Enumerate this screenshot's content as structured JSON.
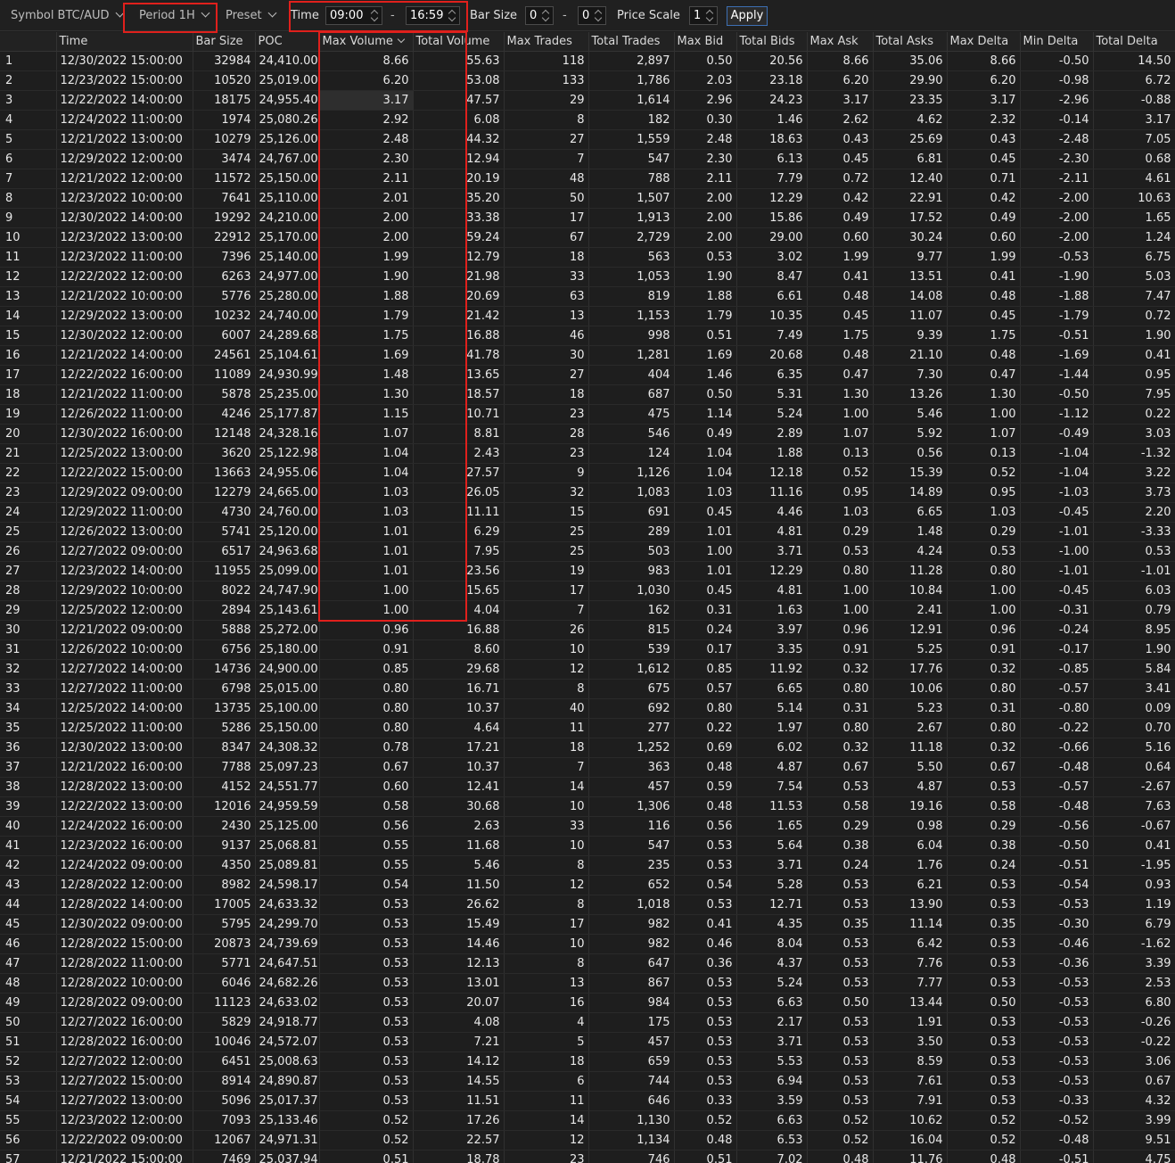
{
  "toolbar": {
    "symbol_label": "Symbol BTC/AUD",
    "period_label": "Period 1H",
    "preset_label": "Preset",
    "time_label": "Time",
    "time_from": "09:00",
    "time_dash": "-",
    "time_to": "16:59",
    "barsize_label": "Bar Size",
    "barsize_from": "0",
    "barsize_dash": "-",
    "barsize_to": "0",
    "pricescale_label": "Price Scale",
    "pricescale_value": "1",
    "apply_label": "Apply"
  },
  "table": {
    "columns": [
      "",
      "Time",
      "Bar Size",
      "POC",
      "Max Volume",
      "Total Volume",
      "Max Trades",
      "Total Trades",
      "Max Bid",
      "Total Bids",
      "Max Ask",
      "Total Asks",
      "Max Delta",
      "Min Delta",
      "Total Delta"
    ],
    "sorted_column": "Max Volume",
    "rows": [
      [
        "1",
        "12/30/2022 15:00:00",
        "32984",
        "24,410.00",
        "8.66",
        "55.63",
        "118",
        "2,897",
        "0.50",
        "20.56",
        "8.66",
        "35.06",
        "8.66",
        "-0.50",
        "14.50"
      ],
      [
        "2",
        "12/23/2022 15:00:00",
        "10520",
        "25,019.00",
        "6.20",
        "53.08",
        "133",
        "1,786",
        "2.03",
        "23.18",
        "6.20",
        "29.90",
        "6.20",
        "-0.98",
        "6.72"
      ],
      [
        "3",
        "12/22/2022 14:00:00",
        "18175",
        "24,955.40",
        "3.17",
        "47.57",
        "29",
        "1,614",
        "2.96",
        "24.23",
        "3.17",
        "23.35",
        "3.17",
        "-2.96",
        "-0.88"
      ],
      [
        "4",
        "12/24/2022 11:00:00",
        "1974",
        "25,080.26",
        "2.92",
        "6.08",
        "8",
        "182",
        "0.30",
        "1.46",
        "2.62",
        "4.62",
        "2.32",
        "-0.14",
        "3.17"
      ],
      [
        "5",
        "12/21/2022 13:00:00",
        "10279",
        "25,126.00",
        "2.48",
        "44.32",
        "27",
        "1,559",
        "2.48",
        "18.63",
        "0.43",
        "25.69",
        "0.43",
        "-2.48",
        "7.05"
      ],
      [
        "6",
        "12/29/2022 12:00:00",
        "3474",
        "24,767.00",
        "2.30",
        "12.94",
        "7",
        "547",
        "2.30",
        "6.13",
        "0.45",
        "6.81",
        "0.45",
        "-2.30",
        "0.68"
      ],
      [
        "7",
        "12/21/2022 12:00:00",
        "11572",
        "25,150.00",
        "2.11",
        "20.19",
        "48",
        "788",
        "2.11",
        "7.79",
        "0.72",
        "12.40",
        "0.71",
        "-2.11",
        "4.61"
      ],
      [
        "8",
        "12/23/2022 10:00:00",
        "7641",
        "25,110.00",
        "2.01",
        "35.20",
        "50",
        "1,507",
        "2.00",
        "12.29",
        "0.42",
        "22.91",
        "0.42",
        "-2.00",
        "10.63"
      ],
      [
        "9",
        "12/30/2022 14:00:00",
        "19292",
        "24,210.00",
        "2.00",
        "33.38",
        "17",
        "1,913",
        "2.00",
        "15.86",
        "0.49",
        "17.52",
        "0.49",
        "-2.00",
        "1.65"
      ],
      [
        "10",
        "12/23/2022 13:00:00",
        "22912",
        "25,170.00",
        "2.00",
        "59.24",
        "67",
        "2,729",
        "2.00",
        "29.00",
        "0.60",
        "30.24",
        "0.60",
        "-2.00",
        "1.24"
      ],
      [
        "11",
        "12/23/2022 11:00:00",
        "7396",
        "25,140.00",
        "1.99",
        "12.79",
        "18",
        "563",
        "0.53",
        "3.02",
        "1.99",
        "9.77",
        "1.99",
        "-0.53",
        "6.75"
      ],
      [
        "12",
        "12/22/2022 12:00:00",
        "6263",
        "24,977.00",
        "1.90",
        "21.98",
        "33",
        "1,053",
        "1.90",
        "8.47",
        "0.41",
        "13.51",
        "0.41",
        "-1.90",
        "5.03"
      ],
      [
        "13",
        "12/21/2022 10:00:00",
        "5776",
        "25,280.00",
        "1.88",
        "20.69",
        "63",
        "819",
        "1.88",
        "6.61",
        "0.48",
        "14.08",
        "0.48",
        "-1.88",
        "7.47"
      ],
      [
        "14",
        "12/29/2022 13:00:00",
        "10232",
        "24,740.00",
        "1.79",
        "21.42",
        "13",
        "1,153",
        "1.79",
        "10.35",
        "0.45",
        "11.07",
        "0.45",
        "-1.79",
        "0.72"
      ],
      [
        "15",
        "12/30/2022 12:00:00",
        "6007",
        "24,289.68",
        "1.75",
        "16.88",
        "46",
        "998",
        "0.51",
        "7.49",
        "1.75",
        "9.39",
        "1.75",
        "-0.51",
        "1.90"
      ],
      [
        "16",
        "12/21/2022 14:00:00",
        "24561",
        "25,104.61",
        "1.69",
        "41.78",
        "30",
        "1,281",
        "1.69",
        "20.68",
        "0.48",
        "21.10",
        "0.48",
        "-1.69",
        "0.41"
      ],
      [
        "17",
        "12/22/2022 16:00:00",
        "11089",
        "24,930.99",
        "1.48",
        "13.65",
        "27",
        "404",
        "1.46",
        "6.35",
        "0.47",
        "7.30",
        "0.47",
        "-1.44",
        "0.95"
      ],
      [
        "18",
        "12/21/2022 11:00:00",
        "5878",
        "25,235.00",
        "1.30",
        "18.57",
        "18",
        "687",
        "0.50",
        "5.31",
        "1.30",
        "13.26",
        "1.30",
        "-0.50",
        "7.95"
      ],
      [
        "19",
        "12/26/2022 11:00:00",
        "4246",
        "25,177.87",
        "1.15",
        "10.71",
        "23",
        "475",
        "1.14",
        "5.24",
        "1.00",
        "5.46",
        "1.00",
        "-1.12",
        "0.22"
      ],
      [
        "20",
        "12/30/2022 16:00:00",
        "12148",
        "24,328.16",
        "1.07",
        "8.81",
        "28",
        "546",
        "0.49",
        "2.89",
        "1.07",
        "5.92",
        "1.07",
        "-0.49",
        "3.03"
      ],
      [
        "21",
        "12/25/2022 13:00:00",
        "3620",
        "25,122.98",
        "1.04",
        "2.43",
        "23",
        "124",
        "1.04",
        "1.88",
        "0.13",
        "0.56",
        "0.13",
        "-1.04",
        "-1.32"
      ],
      [
        "22",
        "12/22/2022 15:00:00",
        "13663",
        "24,955.06",
        "1.04",
        "27.57",
        "9",
        "1,126",
        "1.04",
        "12.18",
        "0.52",
        "15.39",
        "0.52",
        "-1.04",
        "3.22"
      ],
      [
        "23",
        "12/29/2022 09:00:00",
        "12279",
        "24,665.00",
        "1.03",
        "26.05",
        "32",
        "1,083",
        "1.03",
        "11.16",
        "0.95",
        "14.89",
        "0.95",
        "-1.03",
        "3.73"
      ],
      [
        "24",
        "12/29/2022 11:00:00",
        "4730",
        "24,760.00",
        "1.03",
        "11.11",
        "15",
        "691",
        "0.45",
        "4.46",
        "1.03",
        "6.65",
        "1.03",
        "-0.45",
        "2.20"
      ],
      [
        "25",
        "12/26/2022 13:00:00",
        "5741",
        "25,120.00",
        "1.01",
        "6.29",
        "25",
        "289",
        "1.01",
        "4.81",
        "0.29",
        "1.48",
        "0.29",
        "-1.01",
        "-3.33"
      ],
      [
        "26",
        "12/27/2022 09:00:00",
        "6517",
        "24,963.68",
        "1.01",
        "7.95",
        "25",
        "503",
        "1.00",
        "3.71",
        "0.53",
        "4.24",
        "0.53",
        "-1.00",
        "0.53"
      ],
      [
        "27",
        "12/23/2022 14:00:00",
        "11955",
        "25,099.00",
        "1.01",
        "23.56",
        "19",
        "983",
        "1.01",
        "12.29",
        "0.80",
        "11.28",
        "0.80",
        "-1.01",
        "-1.01"
      ],
      [
        "28",
        "12/29/2022 10:00:00",
        "8022",
        "24,747.90",
        "1.00",
        "15.65",
        "17",
        "1,030",
        "0.45",
        "4.81",
        "1.00",
        "10.84",
        "1.00",
        "-0.45",
        "6.03"
      ],
      [
        "29",
        "12/25/2022 12:00:00",
        "2894",
        "25,143.61",
        "1.00",
        "4.04",
        "7",
        "162",
        "0.31",
        "1.63",
        "1.00",
        "2.41",
        "1.00",
        "-0.31",
        "0.79"
      ],
      [
        "30",
        "12/21/2022 09:00:00",
        "5888",
        "25,272.00",
        "0.96",
        "16.88",
        "26",
        "815",
        "0.24",
        "3.97",
        "0.96",
        "12.91",
        "0.96",
        "-0.24",
        "8.95"
      ],
      [
        "31",
        "12/26/2022 10:00:00",
        "6756",
        "25,180.00",
        "0.91",
        "8.60",
        "10",
        "539",
        "0.17",
        "3.35",
        "0.91",
        "5.25",
        "0.91",
        "-0.17",
        "1.90"
      ],
      [
        "32",
        "12/27/2022 14:00:00",
        "14736",
        "24,900.00",
        "0.85",
        "29.68",
        "12",
        "1,612",
        "0.85",
        "11.92",
        "0.32",
        "17.76",
        "0.32",
        "-0.85",
        "5.84"
      ],
      [
        "33",
        "12/27/2022 11:00:00",
        "6798",
        "25,015.00",
        "0.80",
        "16.71",
        "8",
        "675",
        "0.57",
        "6.65",
        "0.80",
        "10.06",
        "0.80",
        "-0.57",
        "3.41"
      ],
      [
        "34",
        "12/25/2022 14:00:00",
        "13735",
        "25,100.00",
        "0.80",
        "10.37",
        "40",
        "692",
        "0.80",
        "5.14",
        "0.31",
        "5.23",
        "0.31",
        "-0.80",
        "0.09"
      ],
      [
        "35",
        "12/25/2022 11:00:00",
        "5286",
        "25,150.00",
        "0.80",
        "4.64",
        "11",
        "277",
        "0.22",
        "1.97",
        "0.80",
        "2.67",
        "0.80",
        "-0.22",
        "0.70"
      ],
      [
        "36",
        "12/30/2022 13:00:00",
        "8347",
        "24,308.32",
        "0.78",
        "17.21",
        "18",
        "1,252",
        "0.69",
        "6.02",
        "0.32",
        "11.18",
        "0.32",
        "-0.66",
        "5.16"
      ],
      [
        "37",
        "12/21/2022 16:00:00",
        "7788",
        "25,097.23",
        "0.67",
        "10.37",
        "7",
        "363",
        "0.48",
        "4.87",
        "0.67",
        "5.50",
        "0.67",
        "-0.48",
        "0.64"
      ],
      [
        "38",
        "12/28/2022 13:00:00",
        "4152",
        "24,551.77",
        "0.60",
        "12.41",
        "14",
        "457",
        "0.59",
        "7.54",
        "0.53",
        "4.87",
        "0.53",
        "-0.57",
        "-2.67"
      ],
      [
        "39",
        "12/22/2022 13:00:00",
        "12016",
        "24,959.59",
        "0.58",
        "30.68",
        "10",
        "1,306",
        "0.48",
        "11.53",
        "0.58",
        "19.16",
        "0.58",
        "-0.48",
        "7.63"
      ],
      [
        "40",
        "12/24/2022 16:00:00",
        "2430",
        "25,125.00",
        "0.56",
        "2.63",
        "33",
        "116",
        "0.56",
        "1.65",
        "0.29",
        "0.98",
        "0.29",
        "-0.56",
        "-0.67"
      ],
      [
        "41",
        "12/23/2022 16:00:00",
        "9137",
        "25,068.81",
        "0.55",
        "11.68",
        "10",
        "547",
        "0.53",
        "5.64",
        "0.38",
        "6.04",
        "0.38",
        "-0.50",
        "0.41"
      ],
      [
        "42",
        "12/24/2022 09:00:00",
        "4350",
        "25,089.81",
        "0.55",
        "5.46",
        "8",
        "235",
        "0.53",
        "3.71",
        "0.24",
        "1.76",
        "0.24",
        "-0.51",
        "-1.95"
      ],
      [
        "43",
        "12/28/2022 12:00:00",
        "8982",
        "24,598.17",
        "0.54",
        "11.50",
        "12",
        "652",
        "0.54",
        "5.28",
        "0.53",
        "6.21",
        "0.53",
        "-0.54",
        "0.93"
      ],
      [
        "44",
        "12/28/2022 14:00:00",
        "17005",
        "24,633.32",
        "0.53",
        "26.62",
        "8",
        "1,018",
        "0.53",
        "12.71",
        "0.53",
        "13.90",
        "0.53",
        "-0.53",
        "1.19"
      ],
      [
        "45",
        "12/30/2022 09:00:00",
        "5795",
        "24,299.70",
        "0.53",
        "15.49",
        "17",
        "982",
        "0.41",
        "4.35",
        "0.35",
        "11.14",
        "0.35",
        "-0.30",
        "6.79"
      ],
      [
        "46",
        "12/28/2022 15:00:00",
        "20873",
        "24,739.69",
        "0.53",
        "14.46",
        "10",
        "982",
        "0.46",
        "8.04",
        "0.53",
        "6.42",
        "0.53",
        "-0.46",
        "-1.62"
      ],
      [
        "47",
        "12/28/2022 11:00:00",
        "5771",
        "24,647.51",
        "0.53",
        "12.13",
        "8",
        "647",
        "0.36",
        "4.37",
        "0.53",
        "7.76",
        "0.53",
        "-0.36",
        "3.39"
      ],
      [
        "48",
        "12/28/2022 10:00:00",
        "6046",
        "24,682.26",
        "0.53",
        "13.01",
        "13",
        "867",
        "0.53",
        "5.24",
        "0.53",
        "7.77",
        "0.53",
        "-0.53",
        "2.53"
      ],
      [
        "49",
        "12/28/2022 09:00:00",
        "11123",
        "24,633.02",
        "0.53",
        "20.07",
        "16",
        "984",
        "0.53",
        "6.63",
        "0.50",
        "13.44",
        "0.50",
        "-0.53",
        "6.80"
      ],
      [
        "50",
        "12/27/2022 16:00:00",
        "5829",
        "24,918.77",
        "0.53",
        "4.08",
        "4",
        "175",
        "0.53",
        "2.17",
        "0.53",
        "1.91",
        "0.53",
        "-0.53",
        "-0.26"
      ],
      [
        "51",
        "12/28/2022 16:00:00",
        "10046",
        "24,572.07",
        "0.53",
        "7.21",
        "5",
        "457",
        "0.53",
        "3.71",
        "0.53",
        "3.50",
        "0.53",
        "-0.53",
        "-0.22"
      ],
      [
        "52",
        "12/27/2022 12:00:00",
        "6451",
        "25,008.63",
        "0.53",
        "14.12",
        "18",
        "659",
        "0.53",
        "5.53",
        "0.53",
        "8.59",
        "0.53",
        "-0.53",
        "3.06"
      ],
      [
        "53",
        "12/27/2022 15:00:00",
        "8914",
        "24,890.87",
        "0.53",
        "14.55",
        "6",
        "744",
        "0.53",
        "6.94",
        "0.53",
        "7.61",
        "0.53",
        "-0.53",
        "0.67"
      ],
      [
        "54",
        "12/27/2022 13:00:00",
        "5096",
        "25,017.37",
        "0.53",
        "11.51",
        "11",
        "646",
        "0.33",
        "3.59",
        "0.53",
        "7.91",
        "0.53",
        "-0.33",
        "4.32"
      ],
      [
        "55",
        "12/23/2022 12:00:00",
        "7093",
        "25,133.46",
        "0.52",
        "17.26",
        "14",
        "1,130",
        "0.52",
        "6.63",
        "0.52",
        "10.62",
        "0.52",
        "-0.52",
        "3.99"
      ],
      [
        "56",
        "12/22/2022 09:00:00",
        "12067",
        "24,971.31",
        "0.52",
        "22.57",
        "12",
        "1,134",
        "0.48",
        "6.53",
        "0.52",
        "16.04",
        "0.52",
        "-0.48",
        "9.51"
      ],
      [
        "57",
        "12/21/2022 15:00:00",
        "7469",
        "25,037.94",
        "0.51",
        "18.78",
        "23",
        "746",
        "0.51",
        "7.02",
        "0.48",
        "11.76",
        "0.48",
        "-0.51",
        "4.75"
      ]
    ]
  },
  "colors": {
    "background": "#1e1e1e",
    "highlight": "#e0201c",
    "apply_border": "#3d6fb3"
  }
}
